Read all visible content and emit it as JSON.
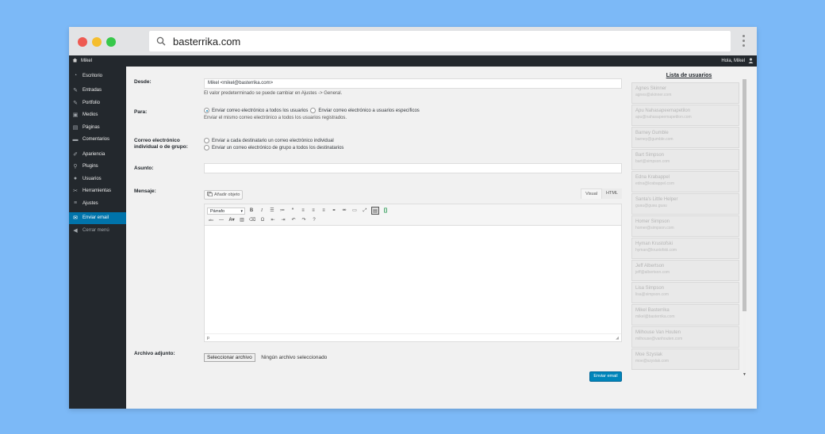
{
  "browser": {
    "url": "basterrika.com"
  },
  "adminbar": {
    "site": "Mikel",
    "greeting": "Hola, Mikel"
  },
  "sidebar": {
    "items": [
      {
        "label": "Escritorio",
        "icon": "dashboard-icon"
      },
      {
        "label": "Entradas",
        "icon": "pin-icon"
      },
      {
        "label": "Portfolio",
        "icon": "pin-icon"
      },
      {
        "label": "Medios",
        "icon": "media-icon"
      },
      {
        "label": "Páginas",
        "icon": "page-icon"
      },
      {
        "label": "Comentarios",
        "icon": "comment-icon"
      },
      {
        "label": "Apariencia",
        "icon": "brush-icon"
      },
      {
        "label": "Plugins",
        "icon": "plugin-icon"
      },
      {
        "label": "Usuarios",
        "icon": "users-icon"
      },
      {
        "label": "Herramientas",
        "icon": "tools-icon"
      },
      {
        "label": "Ajustes",
        "icon": "settings-icon"
      },
      {
        "label": "Enviar email",
        "icon": "email-icon"
      },
      {
        "label": "Cerrar menú",
        "icon": "collapse-icon"
      }
    ]
  },
  "form": {
    "from_label": "Desde:",
    "from_value": "Mikel <mikel@basterrika.com>",
    "from_desc": "El valor predeterminado se puede cambiar en Ajustes -> General.",
    "to_label": "Para:",
    "to_all": "Enviar correo electrónico a todos los usuarios",
    "to_specific": "Enviar correo electrónico a usuarios específicos",
    "to_desc": "Enviar el mismo correo electrónico a todos los usuarios registrados.",
    "mode_label_1": "Correo electrónico",
    "mode_label_2": "individual o de grupo:",
    "mode_individual": "Enviar a cada destinatario un correo electrónico individual",
    "mode_group": "Enviar un correo electrónico de grupo a todos los destinatarios",
    "subject_label": "Asunto:",
    "message_label": "Mensaje:",
    "add_media": "Añadir objeto",
    "tab_visual": "Visual",
    "tab_html": "HTML",
    "format_select": "Párrafo",
    "editor_path": "p",
    "attachment_label": "Archivo adjunto:",
    "file_button": "Seleccionar archivo",
    "file_none": "Ningún archivo seleccionado",
    "send_button": "Enviar email"
  },
  "users": {
    "title": "Lista de usuarios",
    "list": [
      {
        "name": "Agnes Skinner",
        "email": "agnes@skinner.com"
      },
      {
        "name": "Apu Nahasapeemapetilon",
        "email": "apu@nahasapeemapetilon.com"
      },
      {
        "name": "Barney Gumble",
        "email": "barney@gumble.com"
      },
      {
        "name": "Bart Simpson",
        "email": "bart@simpson.com"
      },
      {
        "name": "Edna Krabappel",
        "email": "edna@krabappel.com"
      },
      {
        "name": "Santa's Little Helper",
        "email": "guau@guau.guau"
      },
      {
        "name": "Homer Simpson",
        "email": "homer@simpson.com"
      },
      {
        "name": "Hyman Krustofski",
        "email": "hyman@krustofski.com"
      },
      {
        "name": "Jeff Albertson",
        "email": "jeff@albertson.com"
      },
      {
        "name": "Lisa Simpson",
        "email": "lisa@simpson.com"
      },
      {
        "name": "Mikel Basterrika",
        "email": "mikel@basterrika.com"
      },
      {
        "name": "Milhouse Van Houten",
        "email": "milhouse@vanhouten.com"
      },
      {
        "name": "Moe Szyslak",
        "email": "moe@szyslak.com"
      }
    ]
  }
}
